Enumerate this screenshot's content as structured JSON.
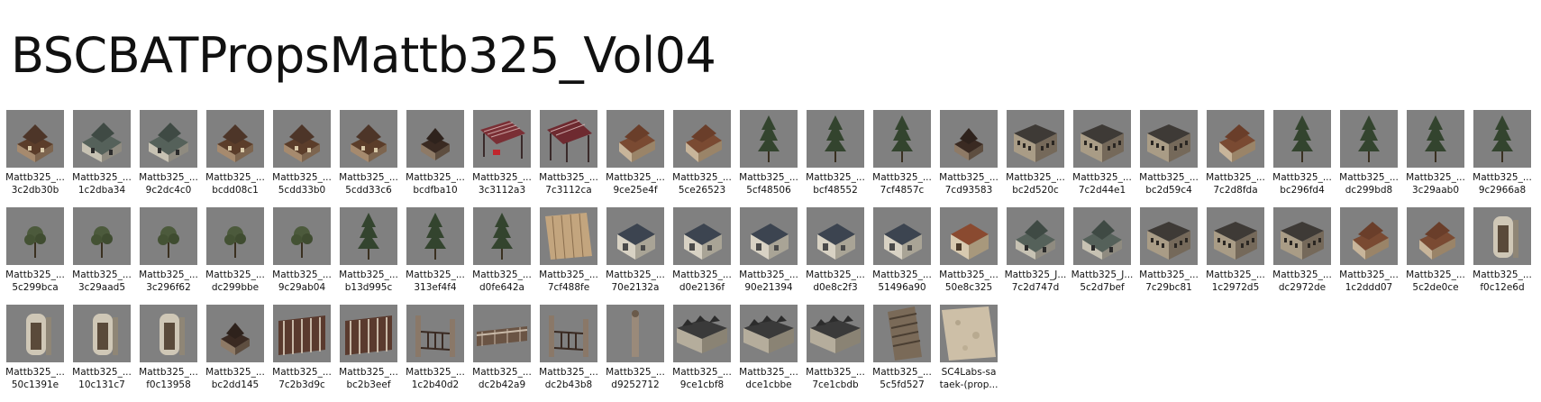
{
  "title": "BSCBATPropsMattb325_Vol04",
  "items": [
    {
      "line1": "Mattb325_...",
      "line2": "3c2db30b",
      "icon": "house-icon",
      "kind": "house"
    },
    {
      "line1": "Mattb325_...",
      "line2": "1c2dba34",
      "icon": "house-icon",
      "kind": "house2"
    },
    {
      "line1": "Mattb325_...",
      "line2": "9c2dc4c0",
      "icon": "house-icon",
      "kind": "house2"
    },
    {
      "line1": "Mattb325_...",
      "line2": "bcdd08c1",
      "icon": "house-icon",
      "kind": "house"
    },
    {
      "line1": "Mattb325_...",
      "line2": "5cdd33b0",
      "icon": "house-icon",
      "kind": "house"
    },
    {
      "line1": "Mattb325_...",
      "line2": "5cdd33c6",
      "icon": "house-icon",
      "kind": "house"
    },
    {
      "line1": "Mattb325_...",
      "line2": "bcdfba10",
      "icon": "house-icon",
      "kind": "small"
    },
    {
      "line1": "Mattb325_...",
      "line2": "3c3112a3",
      "icon": "pergola-icon",
      "kind": "pergola"
    },
    {
      "line1": "Mattb325_...",
      "line2": "7c3112ca",
      "icon": "pergola-icon",
      "kind": "pergola2"
    },
    {
      "line1": "Mattb325_...",
      "line2": "9ce25e4f",
      "icon": "house-icon",
      "kind": "barn"
    },
    {
      "line1": "Mattb325_...",
      "line2": "5ce26523",
      "icon": "house-icon",
      "kind": "barn"
    },
    {
      "line1": "Mattb325_...",
      "line2": "5cf48506",
      "icon": "tree-icon",
      "kind": "tree"
    },
    {
      "line1": "Mattb325_...",
      "line2": "bcf48552",
      "icon": "tree-icon",
      "kind": "tree"
    },
    {
      "line1": "Mattb325_...",
      "line2": "7cf4857c",
      "icon": "tree-icon",
      "kind": "tree"
    },
    {
      "line1": "Mattb325_...",
      "line2": "7cd93583",
      "icon": "house-icon",
      "kind": "small"
    },
    {
      "line1": "Mattb325_...",
      "line2": "bc2d520c",
      "icon": "building-icon",
      "kind": "block"
    },
    {
      "line1": "Mattb325_...",
      "line2": "7c2d44e1",
      "icon": "building-icon",
      "kind": "block"
    },
    {
      "line1": "Mattb325_...",
      "line2": "bc2d59c4",
      "icon": "building-icon",
      "kind": "block"
    },
    {
      "line1": "Mattb325_...",
      "line2": "7c2d8fda",
      "icon": "house-icon",
      "kind": "barn"
    },
    {
      "line1": "Mattb325_...",
      "line2": "bc296fd4",
      "icon": "tree-icon",
      "kind": "tree"
    },
    {
      "line1": "Mattb325_...",
      "line2": "dc299bd8",
      "icon": "tree-icon",
      "kind": "tree"
    },
    {
      "line1": "Mattb325_...",
      "line2": "3c29aab0",
      "icon": "tree-icon",
      "kind": "tree"
    },
    {
      "line1": "Mattb325_...",
      "line2": "9c2966a8",
      "icon": "tree-icon",
      "kind": "tree"
    },
    {
      "line1": "Mattb325_...",
      "line2": "5c299bca",
      "icon": "tree-icon",
      "kind": "shrub"
    },
    {
      "line1": "Mattb325_...",
      "line2": "3c29aad5",
      "icon": "tree-icon",
      "kind": "shrub"
    },
    {
      "line1": "Mattb325_...",
      "line2": "3c296f62",
      "icon": "tree-icon",
      "kind": "shrub"
    },
    {
      "line1": "Mattb325_...",
      "line2": "dc299bbe",
      "icon": "tree-icon",
      "kind": "shrub"
    },
    {
      "line1": "Mattb325_...",
      "line2": "9c29ab04",
      "icon": "tree-icon",
      "kind": "shrub"
    },
    {
      "line1": "Mattb325_...",
      "line2": "b13d995c",
      "icon": "tree-icon",
      "kind": "tree"
    },
    {
      "line1": "Mattb325_...",
      "line2": "313ef4f4",
      "icon": "tree-icon",
      "kind": "tree"
    },
    {
      "line1": "Mattb325_...",
      "line2": "d0fe642a",
      "icon": "tree-icon",
      "kind": "tree"
    },
    {
      "line1": "Mattb325_...",
      "line2": "7cf488fe",
      "icon": "fence-icon",
      "kind": "panel"
    },
    {
      "line1": "Mattb325_...",
      "line2": "70e2132a",
      "icon": "house-icon",
      "kind": "cottage"
    },
    {
      "line1": "Mattb325_...",
      "line2": "d0e2136f",
      "icon": "house-icon",
      "kind": "cottage"
    },
    {
      "line1": "Mattb325_...",
      "line2": "90e21394",
      "icon": "house-icon",
      "kind": "cottage"
    },
    {
      "line1": "Mattb325_...",
      "line2": "d0e8c2f3",
      "icon": "house-icon",
      "kind": "cottage"
    },
    {
      "line1": "Mattb325_...",
      "line2": "51496a90",
      "icon": "house-icon",
      "kind": "cottage"
    },
    {
      "line1": "Mattb325_...",
      "line2": "50e8c325",
      "icon": "house-icon",
      "kind": "cottage2"
    },
    {
      "line1": "Mattb325_J...",
      "line2": "7c2d747d",
      "icon": "house-icon",
      "kind": "house2"
    },
    {
      "line1": "Mattb325_J...",
      "line2": "5c2d7bef",
      "icon": "house-icon",
      "kind": "house2"
    },
    {
      "line1": "Mattb325_...",
      "line2": "7c29bc81",
      "icon": "building-icon",
      "kind": "block"
    },
    {
      "line1": "Mattb325_...",
      "line2": "1c2972d5",
      "icon": "building-icon",
      "kind": "block"
    },
    {
      "line1": "Mattb325_...",
      "line2": "dc2972de",
      "icon": "building-icon",
      "kind": "block"
    },
    {
      "line1": "Mattb325_...",
      "line2": "1c2ddd07",
      "icon": "house-icon",
      "kind": "barn"
    },
    {
      "line1": "Mattb325_...",
      "line2": "5c2de0ce",
      "icon": "house-icon",
      "kind": "barn"
    },
    {
      "line1": "Mattb325_...",
      "line2": "f0c12e6d",
      "icon": "booth-icon",
      "kind": "booth"
    },
    {
      "line1": "Mattb325_...",
      "line2": "50c1391e",
      "icon": "booth-icon",
      "kind": "booth"
    },
    {
      "line1": "Mattb325_...",
      "line2": "10c131c7",
      "icon": "booth-icon",
      "kind": "booth"
    },
    {
      "line1": "Mattb325_...",
      "line2": "f0c13958",
      "icon": "booth-icon",
      "kind": "booth"
    },
    {
      "line1": "Mattb325_...",
      "line2": "bc2dd145",
      "icon": "house-icon",
      "kind": "small"
    },
    {
      "line1": "Mattb325_...",
      "line2": "7c2b3d9c",
      "icon": "fence-icon",
      "kind": "fence"
    },
    {
      "line1": "Mattb325_...",
      "line2": "bc2b3eef",
      "icon": "fence-icon",
      "kind": "fence"
    },
    {
      "line1": "Mattb325_...",
      "line2": "1c2b40d2",
      "icon": "gate-icon",
      "kind": "gate"
    },
    {
      "line1": "Mattb325_...",
      "line2": "dc2b42a9",
      "icon": "fence-icon",
      "kind": "lowfence"
    },
    {
      "line1": "Mattb325_...",
      "line2": "dc2b43b8",
      "icon": "gate-icon",
      "kind": "gate"
    },
    {
      "line1": "Mattb325_...",
      "line2": "d9252712",
      "icon": "post-icon",
      "kind": "post"
    },
    {
      "line1": "Mattb325_...",
      "line2": "9ce1cbf8",
      "icon": "building-icon",
      "kind": "row"
    },
    {
      "line1": "Mattb325_...",
      "line2": "dce1cbbe",
      "icon": "building-icon",
      "kind": "row"
    },
    {
      "line1": "Mattb325_...",
      "line2": "7ce1cbdb",
      "icon": "building-icon",
      "kind": "row"
    },
    {
      "line1": "Mattb325_...",
      "line2": "5c5fd527",
      "icon": "stairs-icon",
      "kind": "stairs"
    },
    {
      "line1": "SC4Labs-sa",
      "line2": "taek-(prop...",
      "icon": "texture-icon",
      "kind": "texture"
    }
  ]
}
